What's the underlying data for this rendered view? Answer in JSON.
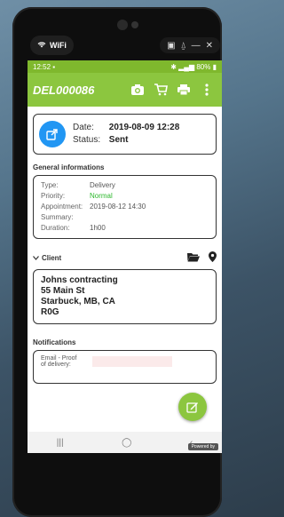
{
  "device": {
    "wifi_label": "WiFi",
    "top_right_icons": [
      "screenshot-icon",
      "bell-icon",
      "minimize-icon",
      "close-icon"
    ]
  },
  "status_bar": {
    "time": "12:52",
    "battery": "80%"
  },
  "app_bar": {
    "title": "DEL000086",
    "actions": [
      "camera-icon",
      "cart-icon",
      "print-icon",
      "more-vertical-icon"
    ]
  },
  "header_card": {
    "date_label": "Date:",
    "date_value": "2019-08-09 12:28",
    "status_label": "Status:",
    "status_value": "Sent"
  },
  "general": {
    "title": "General informations",
    "rows": [
      {
        "key": "Type:",
        "value": "Delivery"
      },
      {
        "key": "Priority:",
        "value": "Normal"
      },
      {
        "key": "Appointment:",
        "value": "2019-08-12 14:30"
      },
      {
        "key": "Summary:",
        "value": ""
      },
      {
        "key": "Duration:",
        "value": "1h00"
      }
    ],
    "priority_color": "#2db82d"
  },
  "client": {
    "title": "Client",
    "name": "Johns contracting",
    "address_line1": "55 Main St",
    "address_line2": "Starbuck, MB, CA",
    "address_line3": "R0G"
  },
  "notifications": {
    "title": "Notifications",
    "label_line1": "Email - Proof",
    "label_line2": "of delivery:"
  },
  "footer": {
    "powered": "Powered by"
  },
  "colors": {
    "accent": "#8cc63f",
    "blue": "#2196f3"
  }
}
